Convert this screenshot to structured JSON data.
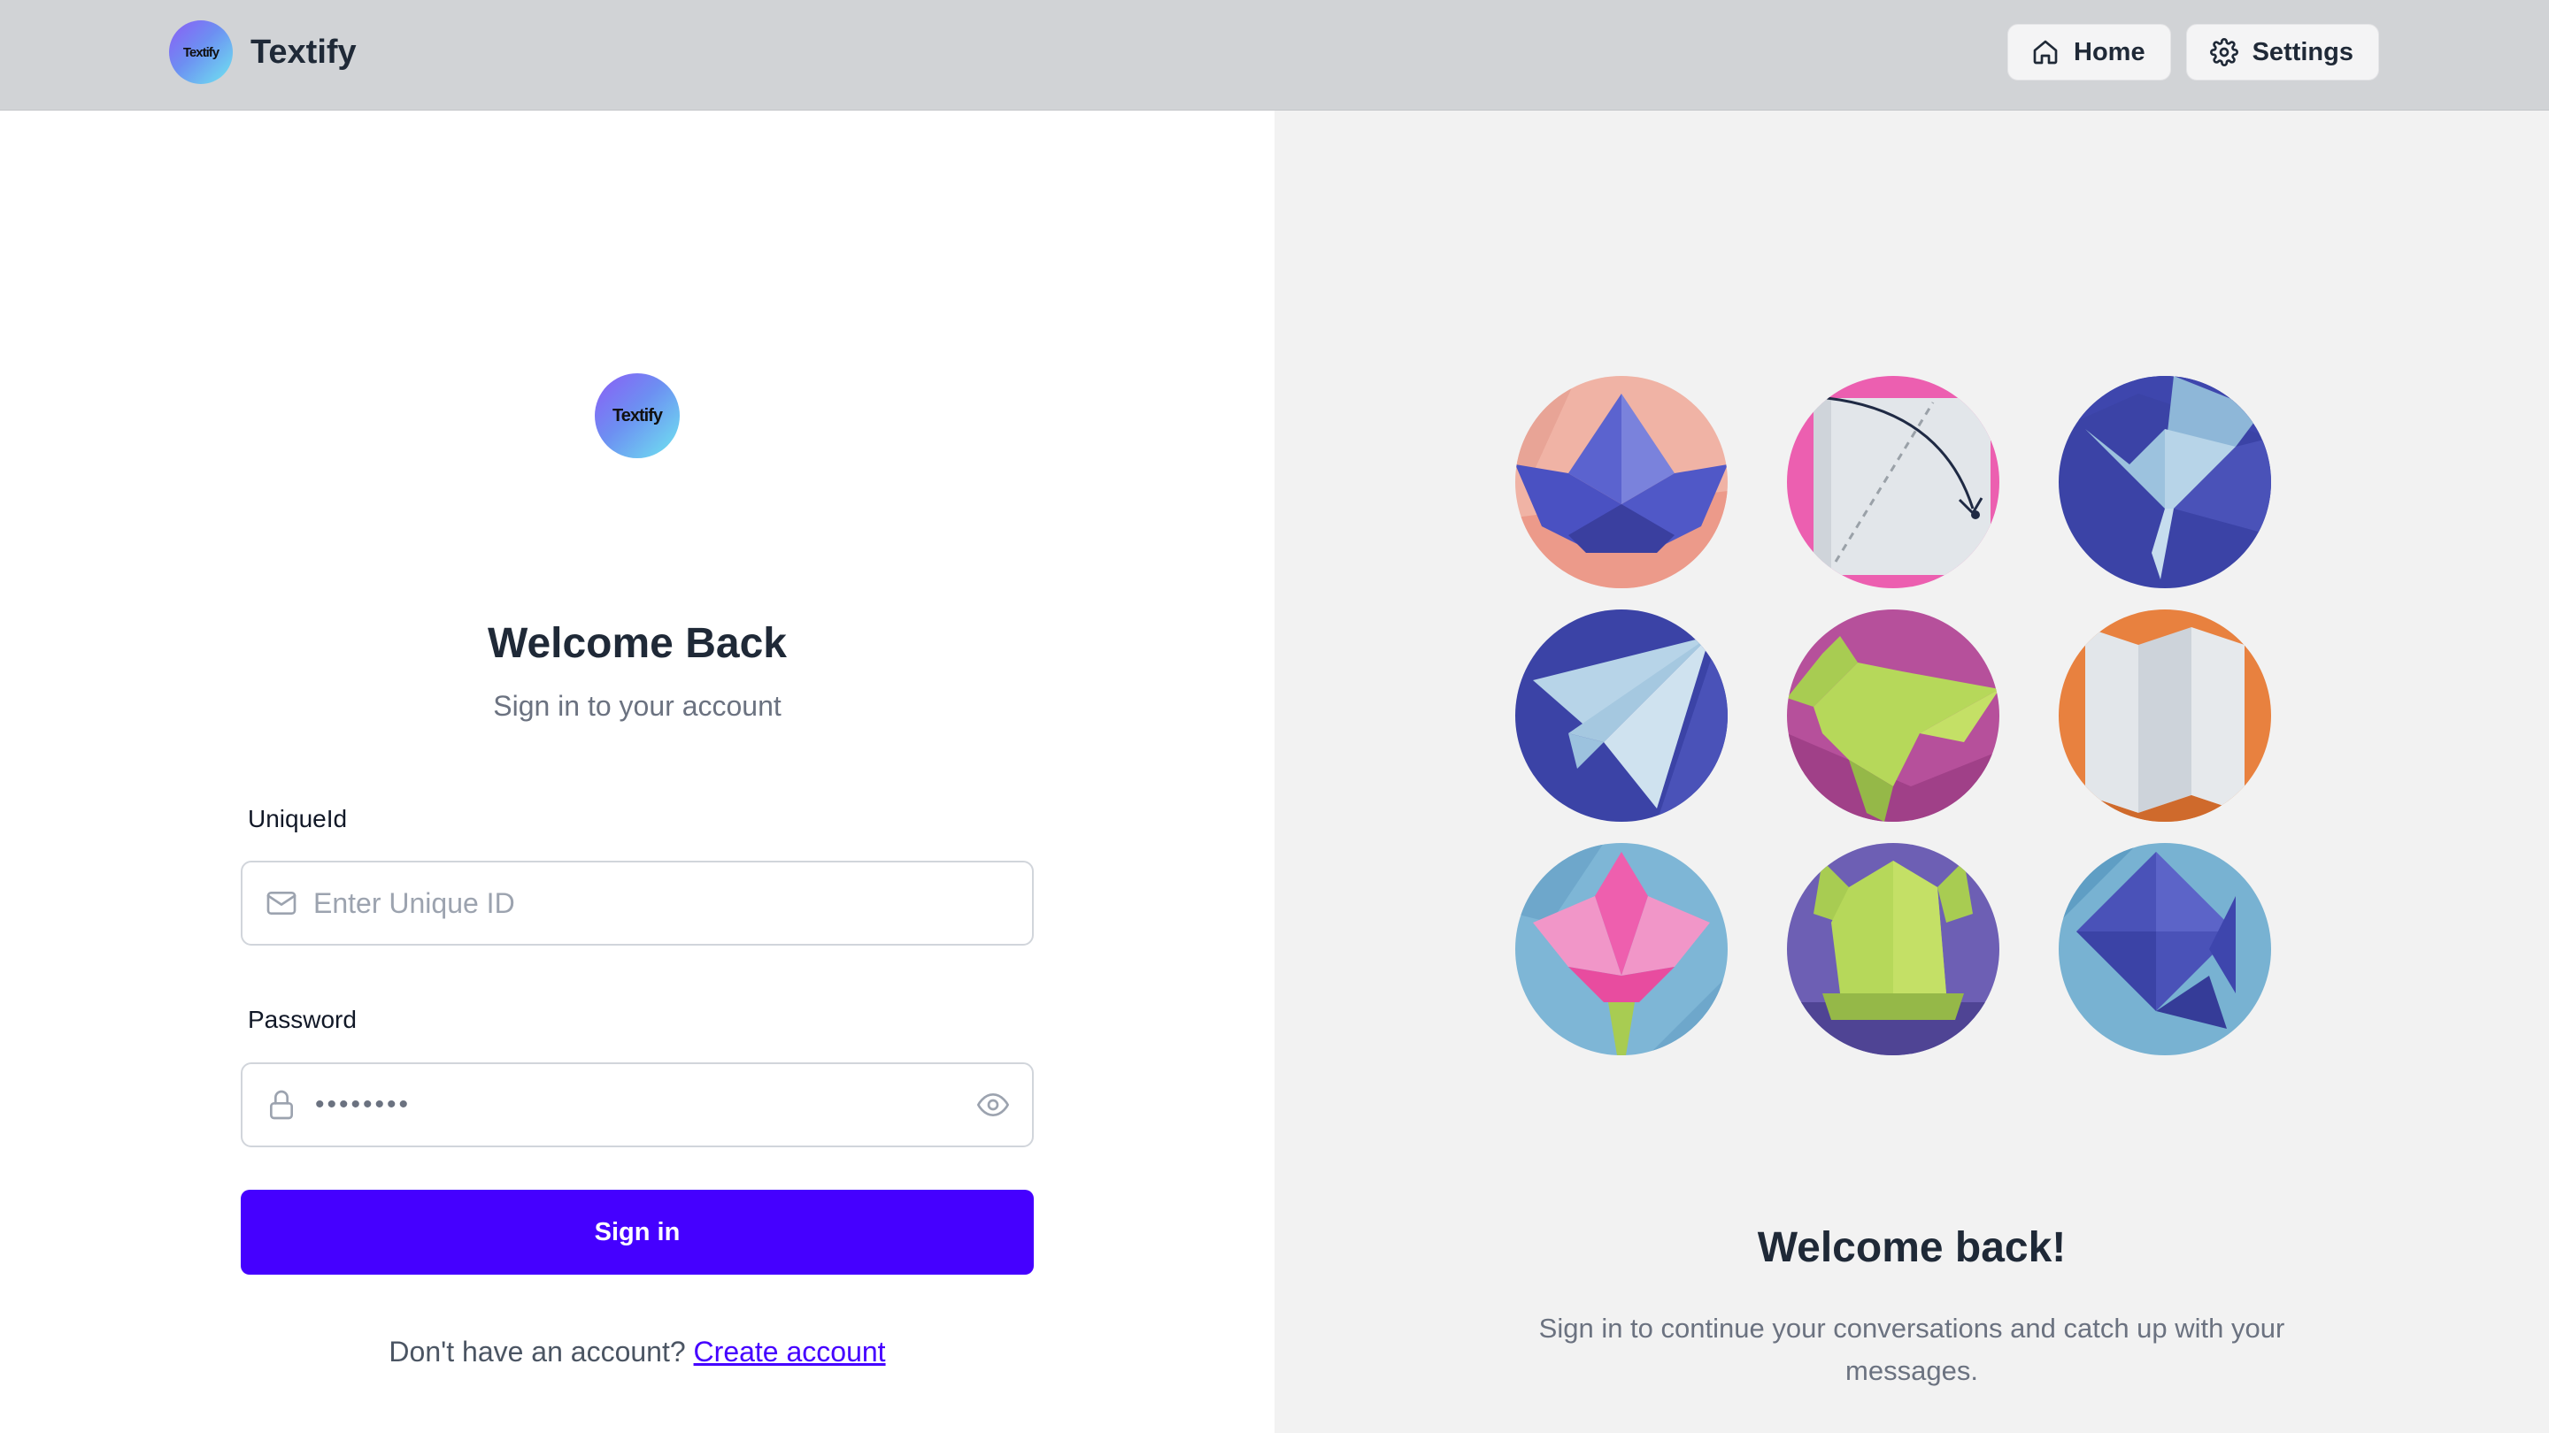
{
  "header": {
    "logo_text": "Textify",
    "brand_name": "Textify",
    "nav": [
      {
        "label": "Home",
        "icon": "home-icon"
      },
      {
        "label": "Settings",
        "icon": "gear-icon"
      }
    ]
  },
  "login": {
    "logo_text": "Textify",
    "title": "Welcome Back",
    "subtitle": "Sign in to your account",
    "uniqueid_label": "UniqueId",
    "uniqueid_placeholder": "Enter Unique ID",
    "uniqueid_value": "",
    "password_label": "Password",
    "password_value": "••••••••",
    "submit_label": "Sign in",
    "signup_prompt": "Don't have an account?",
    "signup_link": "Create account"
  },
  "promo": {
    "title": "Welcome back!",
    "text": "Sign in to continue your conversations and catch up with your messages.",
    "artwork": [
      "origami-boat-icon",
      "paper-fold-diagram-icon",
      "origami-crane-icon",
      "paper-plane-icon",
      "origami-dinosaur-icon",
      "folded-map-icon",
      "origami-lotus-icon",
      "origami-frog-icon",
      "origami-star-icon"
    ]
  },
  "colors": {
    "accent": "#4500ff",
    "header_bg": "#d1d3d6",
    "right_panel_bg": "#f2f2f2"
  }
}
